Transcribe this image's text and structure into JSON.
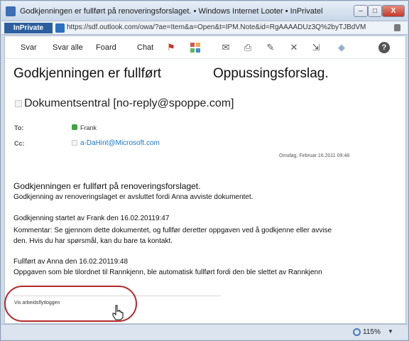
{
  "window": {
    "title": "Godkjenningen er fullført på renoveringsforslaget. • Windows Internet Looter • InPrivatel",
    "buttons": {
      "minimize": "–",
      "maximize": "□",
      "close": "X"
    }
  },
  "addressbar": {
    "badge": "InPrivate",
    "url": "https://sdf.outlook.com/owa/?ae=Item&a=Open&t=IPM.Note&id=RgAAAADUz3Q%2byTJBdVM"
  },
  "toolbar": {
    "reply": "Svar",
    "reply_all": "Svar alle",
    "forward": "Foard",
    "chat": "Chat"
  },
  "message": {
    "subject_left": "Godkjenningen er fullført",
    "subject_right": "Oppussingsforslag.",
    "sender": "Dokumentsentral [no-reply@spoppe.com]",
    "to_label": "To:",
    "to_value": "Frank",
    "cc_label": "Cc:",
    "cc_value": "a-DaHint@Microsoft.com",
    "date": "Onsdag, Februar 16.2011 09:48",
    "body_title": "Godkjenningen er fullført på renoveringsforslaget.",
    "body_line1": "Godkjenning av renoveringslaget er avsluttet fordi Anna avviste dokumentet.",
    "body_line2": "Godkjenning startet av Frank den 16.02.20119:47",
    "body_line3": "Kommentar: Se gjennom dette dokumentet, og fullfør deretter oppgaven ved å godkjenne eller avvise",
    "body_line4": "den. Hvis du har spørsmål, kan du bare ta kontakt.",
    "body_line5": "Fullført av Anna den 16.02.20119:48",
    "body_line6": "Oppgaven som ble tilordnet til Rannkjenn, ble automatisk fullført fordi den ble slettet av Rannkjenn",
    "workflow_link": "Vis arbeidsflytloggen"
  },
  "statusbar": {
    "zoom": "115%"
  },
  "colors": {
    "highlight": "#b22a2a",
    "link": "#1b77c9",
    "inprivate": "#2d5f9e"
  }
}
